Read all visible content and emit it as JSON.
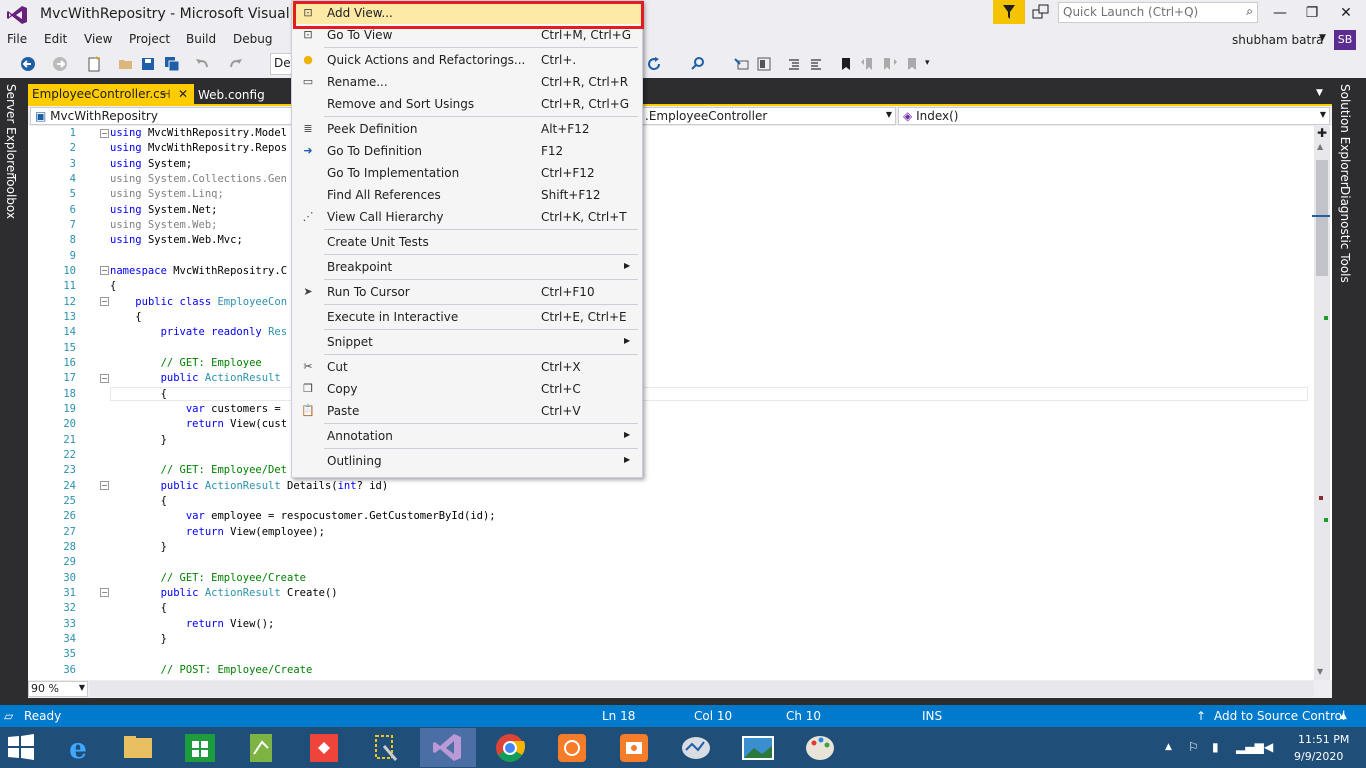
{
  "window": {
    "title": "MvcWithRepositry - Microsoft Visual S",
    "quick_launch_placeholder": "Quick Launch (Ctrl+Q)",
    "user": "shubham batra",
    "avatar": "SB",
    "min": "—",
    "max": "❐",
    "close": "✕"
  },
  "menu": [
    "File",
    "Edit",
    "View",
    "Project",
    "Build",
    "Debug"
  ],
  "toolbar": {
    "config": "De"
  },
  "side_tabs_left": [
    "Server Explorer",
    "Toolbox"
  ],
  "side_tabs_right": [
    "Solution Explorer",
    "Diagnostic Tools"
  ],
  "tabs": {
    "active": "EmployeeController.cs",
    "active_pin": "⊣",
    "active_close": "✕",
    "inactive": "Web.config"
  },
  "navbar": {
    "project": "MvcWithRepositry",
    "class": ".EmployeeController",
    "member": "Index()"
  },
  "editor": {
    "line_numbers": [
      "1",
      "2",
      "3",
      "4",
      "5",
      "6",
      "7",
      "8",
      "9",
      "10",
      "11",
      "12",
      "13",
      "14",
      "15",
      "16",
      "17",
      "18",
      "19",
      "20",
      "21",
      "22",
      "23",
      "24",
      "25",
      "26",
      "27",
      "28",
      "29",
      "30",
      "31",
      "32",
      "33",
      "34",
      "35",
      "36"
    ],
    "lines": [
      [
        [
          "kw",
          "using"
        ],
        [
          "",
          "MvcWithRepositry.Model"
        ]
      ],
      [
        [
          "kw",
          "using"
        ],
        [
          "",
          "MvcWithRepositry.Repos"
        ]
      ],
      [
        [
          "kw",
          "using"
        ],
        [
          "",
          "System;"
        ]
      ],
      [
        [
          "gr",
          "using System.Collections.Gen"
        ]
      ],
      [
        [
          "gr",
          "using System.Linq;"
        ]
      ],
      [
        [
          "kw",
          "using"
        ],
        [
          "",
          "System.Net;"
        ]
      ],
      [
        [
          "gr",
          "using System.Web;"
        ]
      ],
      [
        [
          "kw",
          "using"
        ],
        [
          "",
          "System.Web.Mvc;"
        ]
      ],
      [],
      [
        [
          "kw",
          "namespace"
        ],
        [
          "",
          "MvcWithRepositry.C"
        ]
      ],
      [
        [
          "",
          "{"
        ]
      ],
      [
        [
          "",
          "    "
        ],
        [
          "kw",
          "public class"
        ],
        [
          "ty",
          "EmployeeCon"
        ]
      ],
      [
        [
          "",
          "    {"
        ]
      ],
      [
        [
          "",
          "        "
        ],
        [
          "kw",
          "private readonly"
        ],
        [
          "ty",
          "Res"
        ]
      ],
      [],
      [
        [
          "",
          "        "
        ],
        [
          "cm",
          "// GET: Employee"
        ]
      ],
      [
        [
          "",
          "        "
        ],
        [
          "kw",
          "public"
        ],
        [
          "ty",
          "ActionResult"
        ]
      ],
      [
        [
          "",
          "        {"
        ]
      ],
      [
        [
          "",
          "            "
        ],
        [
          "kw",
          "var"
        ],
        [
          "",
          "customers ="
        ]
      ],
      [
        [
          "",
          "            "
        ],
        [
          "kw",
          "return"
        ],
        [
          "",
          "View(cust"
        ]
      ],
      [
        [
          "",
          "        }"
        ]
      ],
      [],
      [
        [
          "",
          "        "
        ],
        [
          "cm",
          "// GET: Employee/Det"
        ]
      ],
      [
        [
          "",
          "        "
        ],
        [
          "kw",
          "public"
        ],
        [
          "ty",
          "ActionResult"
        ],
        [
          "",
          "Details("
        ],
        [
          "kw",
          "int"
        ],
        [
          "",
          "? id)"
        ]
      ],
      [
        [
          "",
          "        {"
        ]
      ],
      [
        [
          "",
          "            "
        ],
        [
          "kw",
          "var"
        ],
        [
          "",
          "employee = respocustomer.GetCustomerById(id);"
        ]
      ],
      [
        [
          "",
          "            "
        ],
        [
          "kw",
          "return"
        ],
        [
          "",
          "View(employee);"
        ]
      ],
      [
        [
          "",
          "        }"
        ]
      ],
      [],
      [
        [
          "",
          "        "
        ],
        [
          "cm",
          "// GET: Employee/Create"
        ]
      ],
      [
        [
          "",
          "        "
        ],
        [
          "kw",
          "public"
        ],
        [
          "ty",
          "ActionResult"
        ],
        [
          "",
          "Create()"
        ]
      ],
      [
        [
          "",
          "        {"
        ]
      ],
      [
        [
          "",
          "            "
        ],
        [
          "kw",
          "return"
        ],
        [
          "",
          "View();"
        ]
      ],
      [
        [
          "",
          "        }"
        ]
      ],
      [],
      [
        [
          "",
          "        "
        ],
        [
          "cm",
          "// POST: Employee/Create"
        ]
      ]
    ]
  },
  "zoom": "90 %",
  "status": {
    "ready": "Ready",
    "line": "Ln 18",
    "col": "Col 10",
    "ch": "Ch 10",
    "mode": "INS",
    "source_control": "Add to Source Control"
  },
  "clock": {
    "time": "11:51 PM",
    "date": "9/9/2020"
  },
  "context_menu": [
    {
      "label": "Add View...",
      "key": "",
      "icon": "add-view-icon",
      "highlight": true
    },
    {
      "label": "Go To View",
      "key": "Ctrl+M, Ctrl+G",
      "icon": "go-to-view-icon"
    },
    {
      "sep": true
    },
    {
      "label": "Quick Actions and Refactorings...",
      "key": "Ctrl+.",
      "icon": "lightbulb-icon"
    },
    {
      "label": "Rename...",
      "key": "Ctrl+R, Ctrl+R",
      "icon": "rename-icon"
    },
    {
      "label": "Remove and Sort Usings",
      "key": "Ctrl+R, Ctrl+G",
      "icon": ""
    },
    {
      "sep": true
    },
    {
      "label": "Peek Definition",
      "key": "Alt+F12",
      "icon": "peek-icon"
    },
    {
      "label": "Go To Definition",
      "key": "F12",
      "icon": "go-to-definition-icon"
    },
    {
      "label": "Go To Implementation",
      "key": "Ctrl+F12",
      "icon": ""
    },
    {
      "label": "Find All References",
      "key": "Shift+F12",
      "icon": ""
    },
    {
      "label": "View Call Hierarchy",
      "key": "Ctrl+K, Ctrl+T",
      "icon": "call-hierarchy-icon"
    },
    {
      "sep": true
    },
    {
      "label": "Create Unit Tests",
      "key": "",
      "icon": ""
    },
    {
      "sep": true
    },
    {
      "label": "Breakpoint",
      "key": "",
      "icon": "",
      "sub": true
    },
    {
      "sep": true
    },
    {
      "label": "Run To Cursor",
      "key": "Ctrl+F10",
      "icon": "run-to-cursor-icon"
    },
    {
      "sep": true
    },
    {
      "label": "Execute in Interactive",
      "key": "Ctrl+E, Ctrl+E",
      "icon": ""
    },
    {
      "sep": true
    },
    {
      "label": "Snippet",
      "key": "",
      "icon": "",
      "sub": true
    },
    {
      "sep": true
    },
    {
      "label": "Cut",
      "key": "Ctrl+X",
      "icon": "cut-icon"
    },
    {
      "label": "Copy",
      "key": "Ctrl+C",
      "icon": "copy-icon"
    },
    {
      "label": "Paste",
      "key": "Ctrl+V",
      "icon": "paste-icon"
    },
    {
      "sep": true
    },
    {
      "label": "Annotation",
      "key": "",
      "icon": "",
      "sub": true
    },
    {
      "sep": true
    },
    {
      "label": "Outlining",
      "key": "",
      "icon": "",
      "sub": true
    }
  ]
}
